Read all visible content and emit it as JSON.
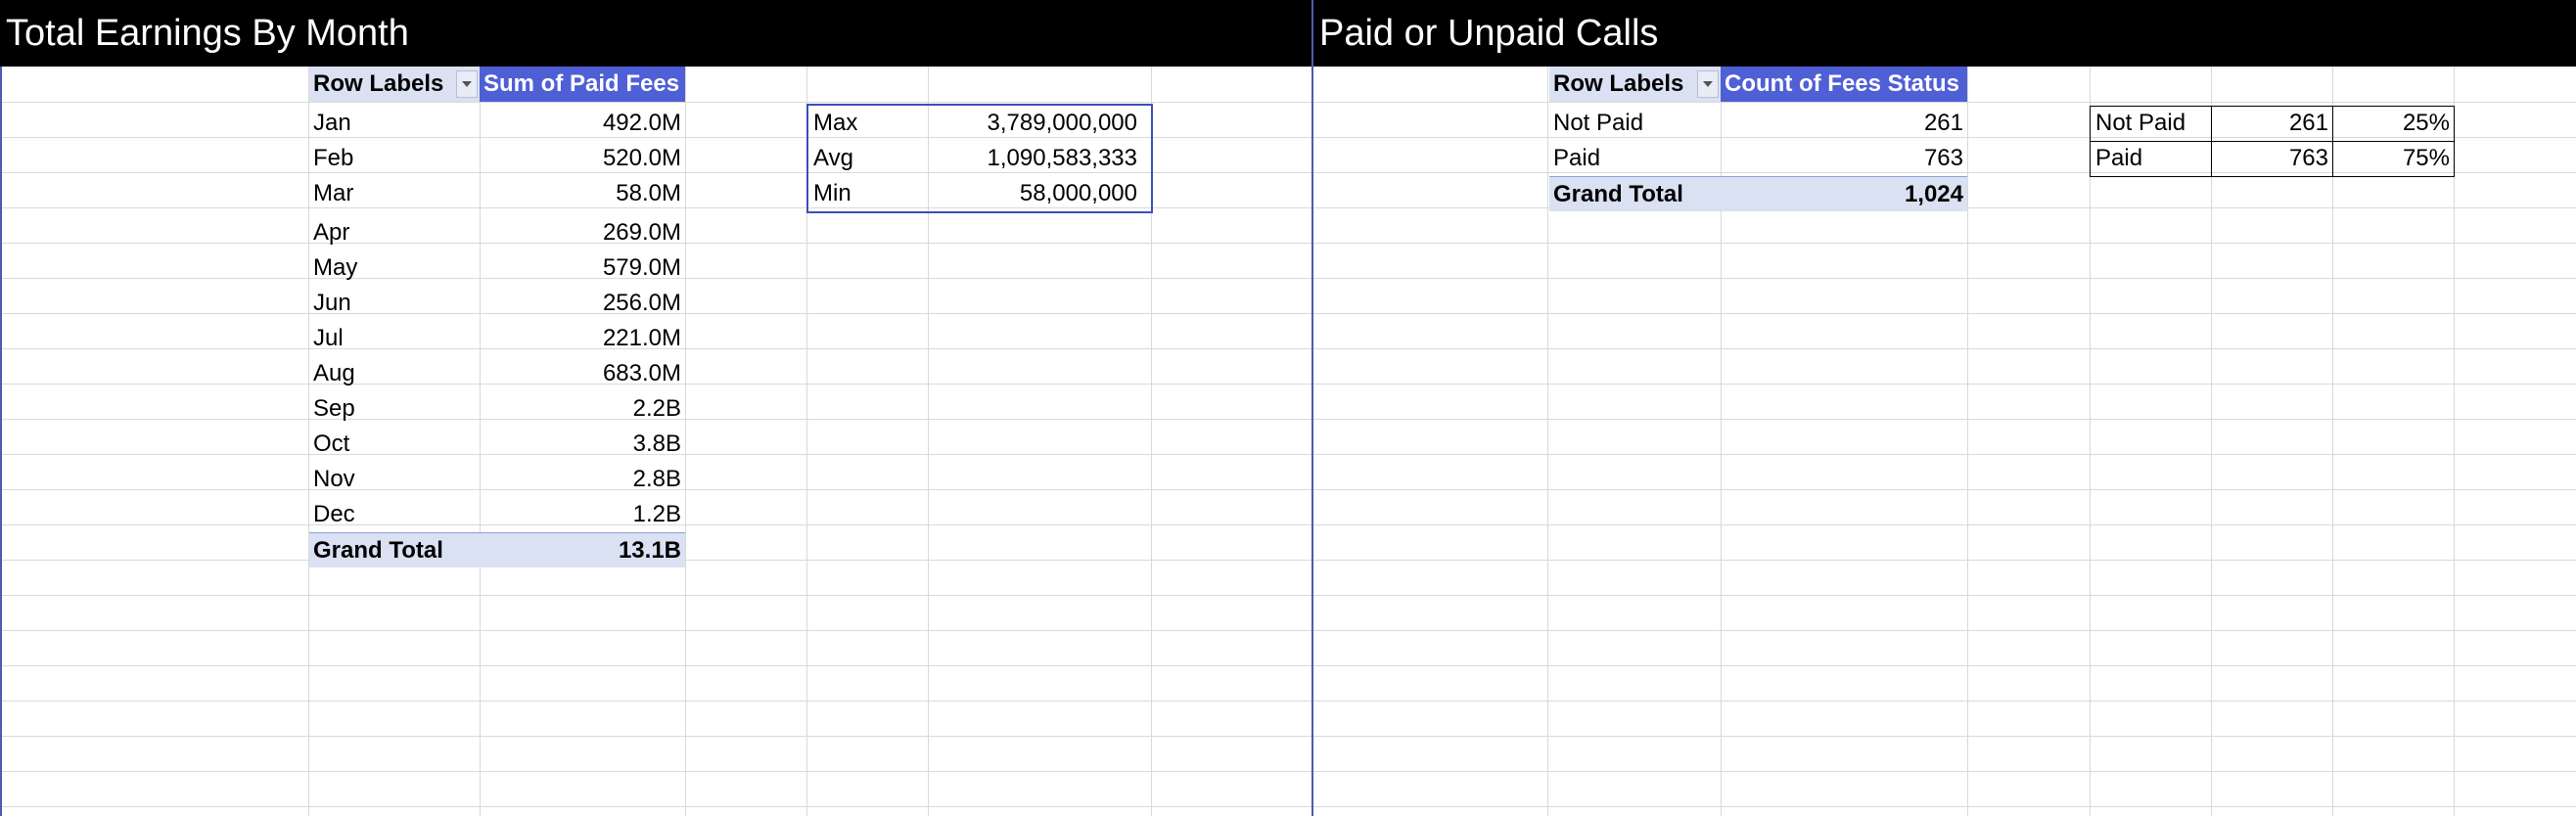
{
  "left_panel": {
    "title": "Total Earnings By Month",
    "pivot": {
      "row_labels_header": "Row Labels",
      "value_header": "Sum of Paid Fees",
      "rows": [
        {
          "label": "Jan",
          "value": "492.0M"
        },
        {
          "label": "Feb",
          "value": "520.0M"
        },
        {
          "label": "Mar",
          "value": "58.0M"
        },
        {
          "label": "Apr",
          "value": "269.0M"
        },
        {
          "label": "May",
          "value": "579.0M"
        },
        {
          "label": "Jun",
          "value": "256.0M"
        },
        {
          "label": "Jul",
          "value": "221.0M"
        },
        {
          "label": "Aug",
          "value": "683.0M"
        },
        {
          "label": "Sep",
          "value": "2.2B"
        },
        {
          "label": "Oct",
          "value": "3.8B"
        },
        {
          "label": "Nov",
          "value": "2.8B"
        },
        {
          "label": "Dec",
          "value": "1.2B"
        }
      ],
      "grand_total_label": "Grand Total",
      "grand_total_value": "13.1B"
    },
    "stats": [
      {
        "label": "Max",
        "value": "3,789,000,000"
      },
      {
        "label": "Avg",
        "value": "1,090,583,333"
      },
      {
        "label": "Min",
        "value": "58,000,000"
      }
    ]
  },
  "right_panel": {
    "title": "Paid or Unpaid Calls",
    "pivot": {
      "row_labels_header": "Row Labels",
      "value_header": "Count of Fees Status",
      "rows": [
        {
          "label": "Not Paid",
          "value": "261"
        },
        {
          "label": "Paid",
          "value": "763"
        }
      ],
      "grand_total_label": "Grand Total",
      "grand_total_value": "1,024"
    },
    "summary": [
      {
        "label": "Not Paid",
        "count": "261",
        "pct": "25%"
      },
      {
        "label": "Paid",
        "count": "763",
        "pct": "75%"
      }
    ]
  },
  "colors": {
    "banner": "#000000",
    "pivot_header_accent": "#4f5fd6",
    "pivot_total_fill": "#d9e1f2",
    "selection_border": "#3b4fb8"
  }
}
